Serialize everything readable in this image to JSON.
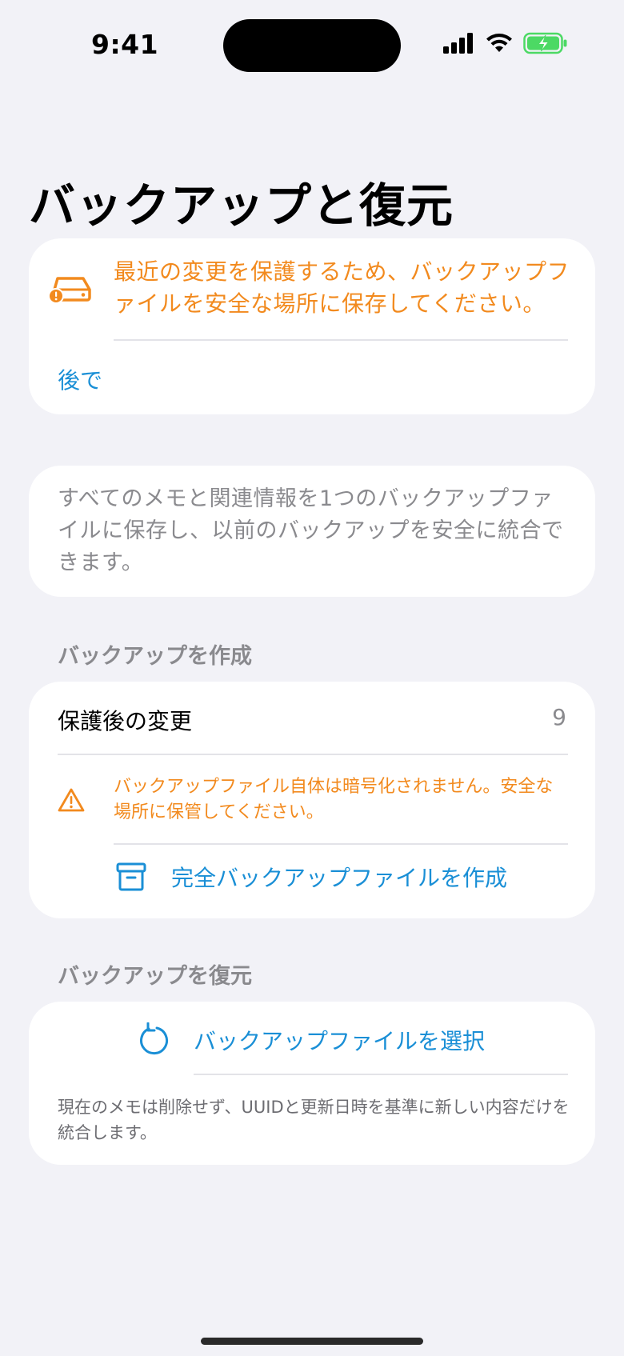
{
  "status_bar": {
    "time": "9:41"
  },
  "page": {
    "title": "バックアップと復元"
  },
  "alert_card": {
    "icon": "drive-warning-icon",
    "message": "最近の変更を保護するため、バックアップファイルを安全な場所に保存してください。",
    "later_button": "後で"
  },
  "info_card": {
    "text": "すべてのメモと関連情報を1つのバックアップファイルに保存し、以前のバックアップを安全に統合できます。"
  },
  "create_section": {
    "header": "バックアップを作成",
    "changes_label": "保護後の変更",
    "changes_count": "9",
    "warning_icon": "warning-triangle-icon",
    "warning_text": "バックアップファイル自体は暗号化されません。安全な場所に保管してください。",
    "create_icon": "archive-box-icon",
    "create_button": "完全バックアップファイルを作成"
  },
  "restore_section": {
    "header": "バックアップを復元",
    "restore_icon": "restore-arrow-icon",
    "select_button": "バックアップファイルを選択",
    "footnote": "現在のメモは削除せず、UUIDと更新日時を基準に新しい内容だけを統合します。"
  },
  "colors": {
    "accent_orange": "#F28A1E",
    "accent_blue": "#1A8FD6",
    "background": "#F2F2F7",
    "battery_green": "#4CD964"
  }
}
